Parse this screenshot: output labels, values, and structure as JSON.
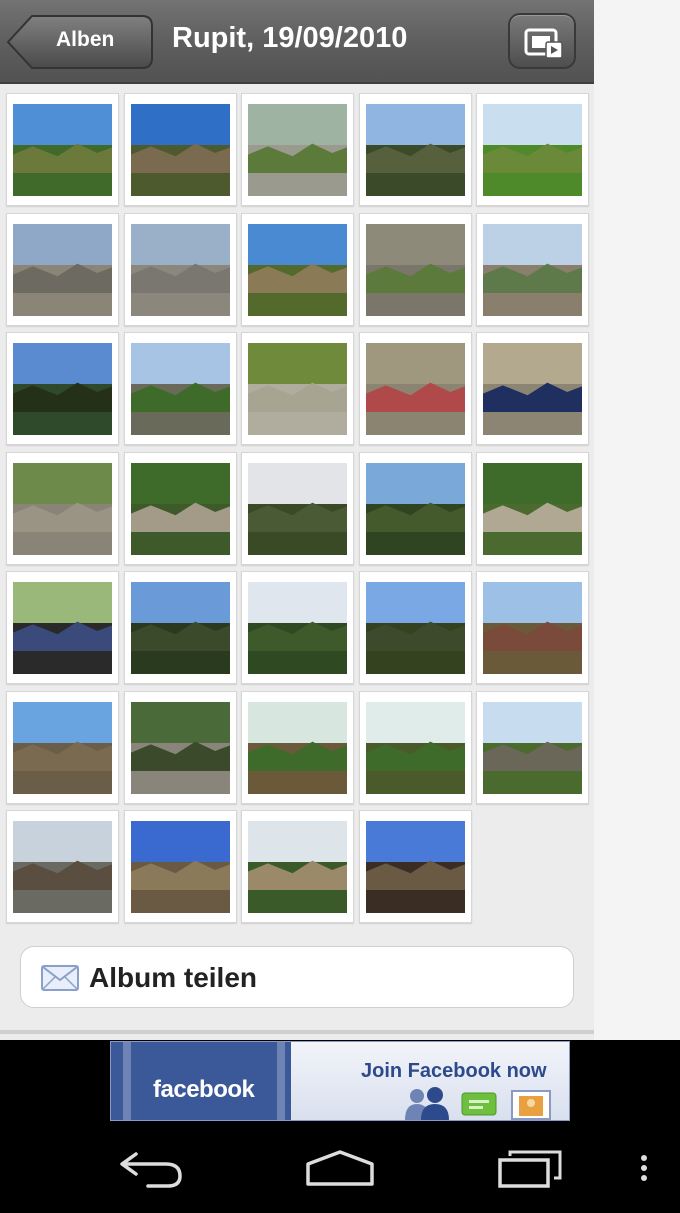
{
  "header": {
    "back_label": "Alben",
    "title": "Rupit, 19/09/2010",
    "slideshow_icon": "slideshow-icon"
  },
  "colors": {
    "header_bg": "#5f5f5f",
    "grid_bg": "#ececec",
    "facebook_blue": "#3b5998"
  },
  "photos": [
    {
      "sky": "#4f8fd6",
      "land": "#6b7a3a",
      "ground": "#3f6a2a"
    },
    {
      "sky": "#2f6fc6",
      "land": "#7a6a50",
      "ground": "#4d5a2e"
    },
    {
      "sky": "#9fb3a2",
      "land": "#5c7a3a",
      "ground": "#9a9a8e"
    },
    {
      "sky": "#8fb5e0",
      "land": "#56603c",
      "ground": "#3b4b2a"
    },
    {
      "sky": "#c9dff0",
      "land": "#6a8a3a",
      "ground": "#4f8a2a"
    },
    {
      "sky": "#8fa8c8",
      "land": "#6d6a62",
      "ground": "#8a8577"
    },
    {
      "sky": "#9ab0c8",
      "land": "#7a7770",
      "ground": "#8c877c"
    },
    {
      "sky": "#4a8ad2",
      "land": "#8a7a55",
      "ground": "#546a2c"
    },
    {
      "sky": "#8d8a7a",
      "land": "#5c7a3c",
      "ground": "#7a766a"
    },
    {
      "sky": "#bcd0e6",
      "land": "#5e7a4a",
      "ground": "#8a7f6d"
    },
    {
      "sky": "#5a8ad0",
      "land": "#243018",
      "ground": "#2f4a2a"
    },
    {
      "sky": "#a8c4e4",
      "land": "#3e6a2a",
      "ground": "#6a6a5a"
    },
    {
      "sky": "#6f8a3a",
      "land": "#a8a492",
      "ground": "#b0ac9e"
    },
    {
      "sky": "#a0987e",
      "land": "#b04a4a",
      "ground": "#8a8470"
    },
    {
      "sky": "#b3a98e",
      "land": "#1f3060",
      "ground": "#8c8574"
    },
    {
      "sky": "#6d8a4a",
      "land": "#9a9484",
      "ground": "#8a8478"
    },
    {
      "sky": "#3e6a2a",
      "land": "#a49a88",
      "ground": "#3e5a2a"
    },
    {
      "sky": "#e2e4e8",
      "land": "#4a5a34",
      "ground": "#3a4a26"
    },
    {
      "sky": "#7aa8d8",
      "land": "#445a2c",
      "ground": "#2f4420"
    },
    {
      "sky": "#3e6a2a",
      "land": "#b0a892",
      "ground": "#4a6a30"
    },
    {
      "sky": "#9ab87a",
      "land": "#3a4a7a",
      "ground": "#2a2a2a"
    },
    {
      "sky": "#6a9ad8",
      "land": "#3a4a2a",
      "ground": "#2a3a1e"
    },
    {
      "sky": "#dfe6ee",
      "land": "#3e5a2a",
      "ground": "#2f4a22"
    },
    {
      "sky": "#7aa8e4",
      "land": "#3e4a2c",
      "ground": "#34421f"
    },
    {
      "sky": "#9cc0e6",
      "land": "#7a4a3a",
      "ground": "#6a5a3a"
    },
    {
      "sky": "#6aa4e0",
      "land": "#7a6a50",
      "ground": "#6a5e48"
    },
    {
      "sky": "#4a6a3a",
      "land": "#3a4a2a",
      "ground": "#8a857a"
    },
    {
      "sky": "#d8e6e0",
      "land": "#3e6a2a",
      "ground": "#6a5a3a"
    },
    {
      "sky": "#e0ecea",
      "land": "#3e6a2a",
      "ground": "#4a5a2a"
    },
    {
      "sky": "#c8dcf0",
      "land": "#6a6658",
      "ground": "#4a6a2e"
    },
    {
      "sky": "#c8d2dc",
      "land": "#5a4e40",
      "ground": "#6a6a62"
    },
    {
      "sky": "#3a6ad0",
      "land": "#8a7a5a",
      "ground": "#6a5a44"
    },
    {
      "sky": "#dde4ea",
      "land": "#9a8a6a",
      "ground": "#3a5a2a"
    },
    {
      "sky": "#4a7ad8",
      "land": "#6a5a44",
      "ground": "#3a2e24"
    }
  ],
  "share": {
    "label": "Album teilen",
    "icon": "envelope-icon"
  },
  "ad": {
    "logo": "facebook",
    "cta": "Join Facebook now"
  },
  "navbar": {
    "back_icon": "back-arrow-icon",
    "home_icon": "home-icon",
    "recents_icon": "recent-apps-icon",
    "menu_icon": "overflow-menu-icon"
  }
}
